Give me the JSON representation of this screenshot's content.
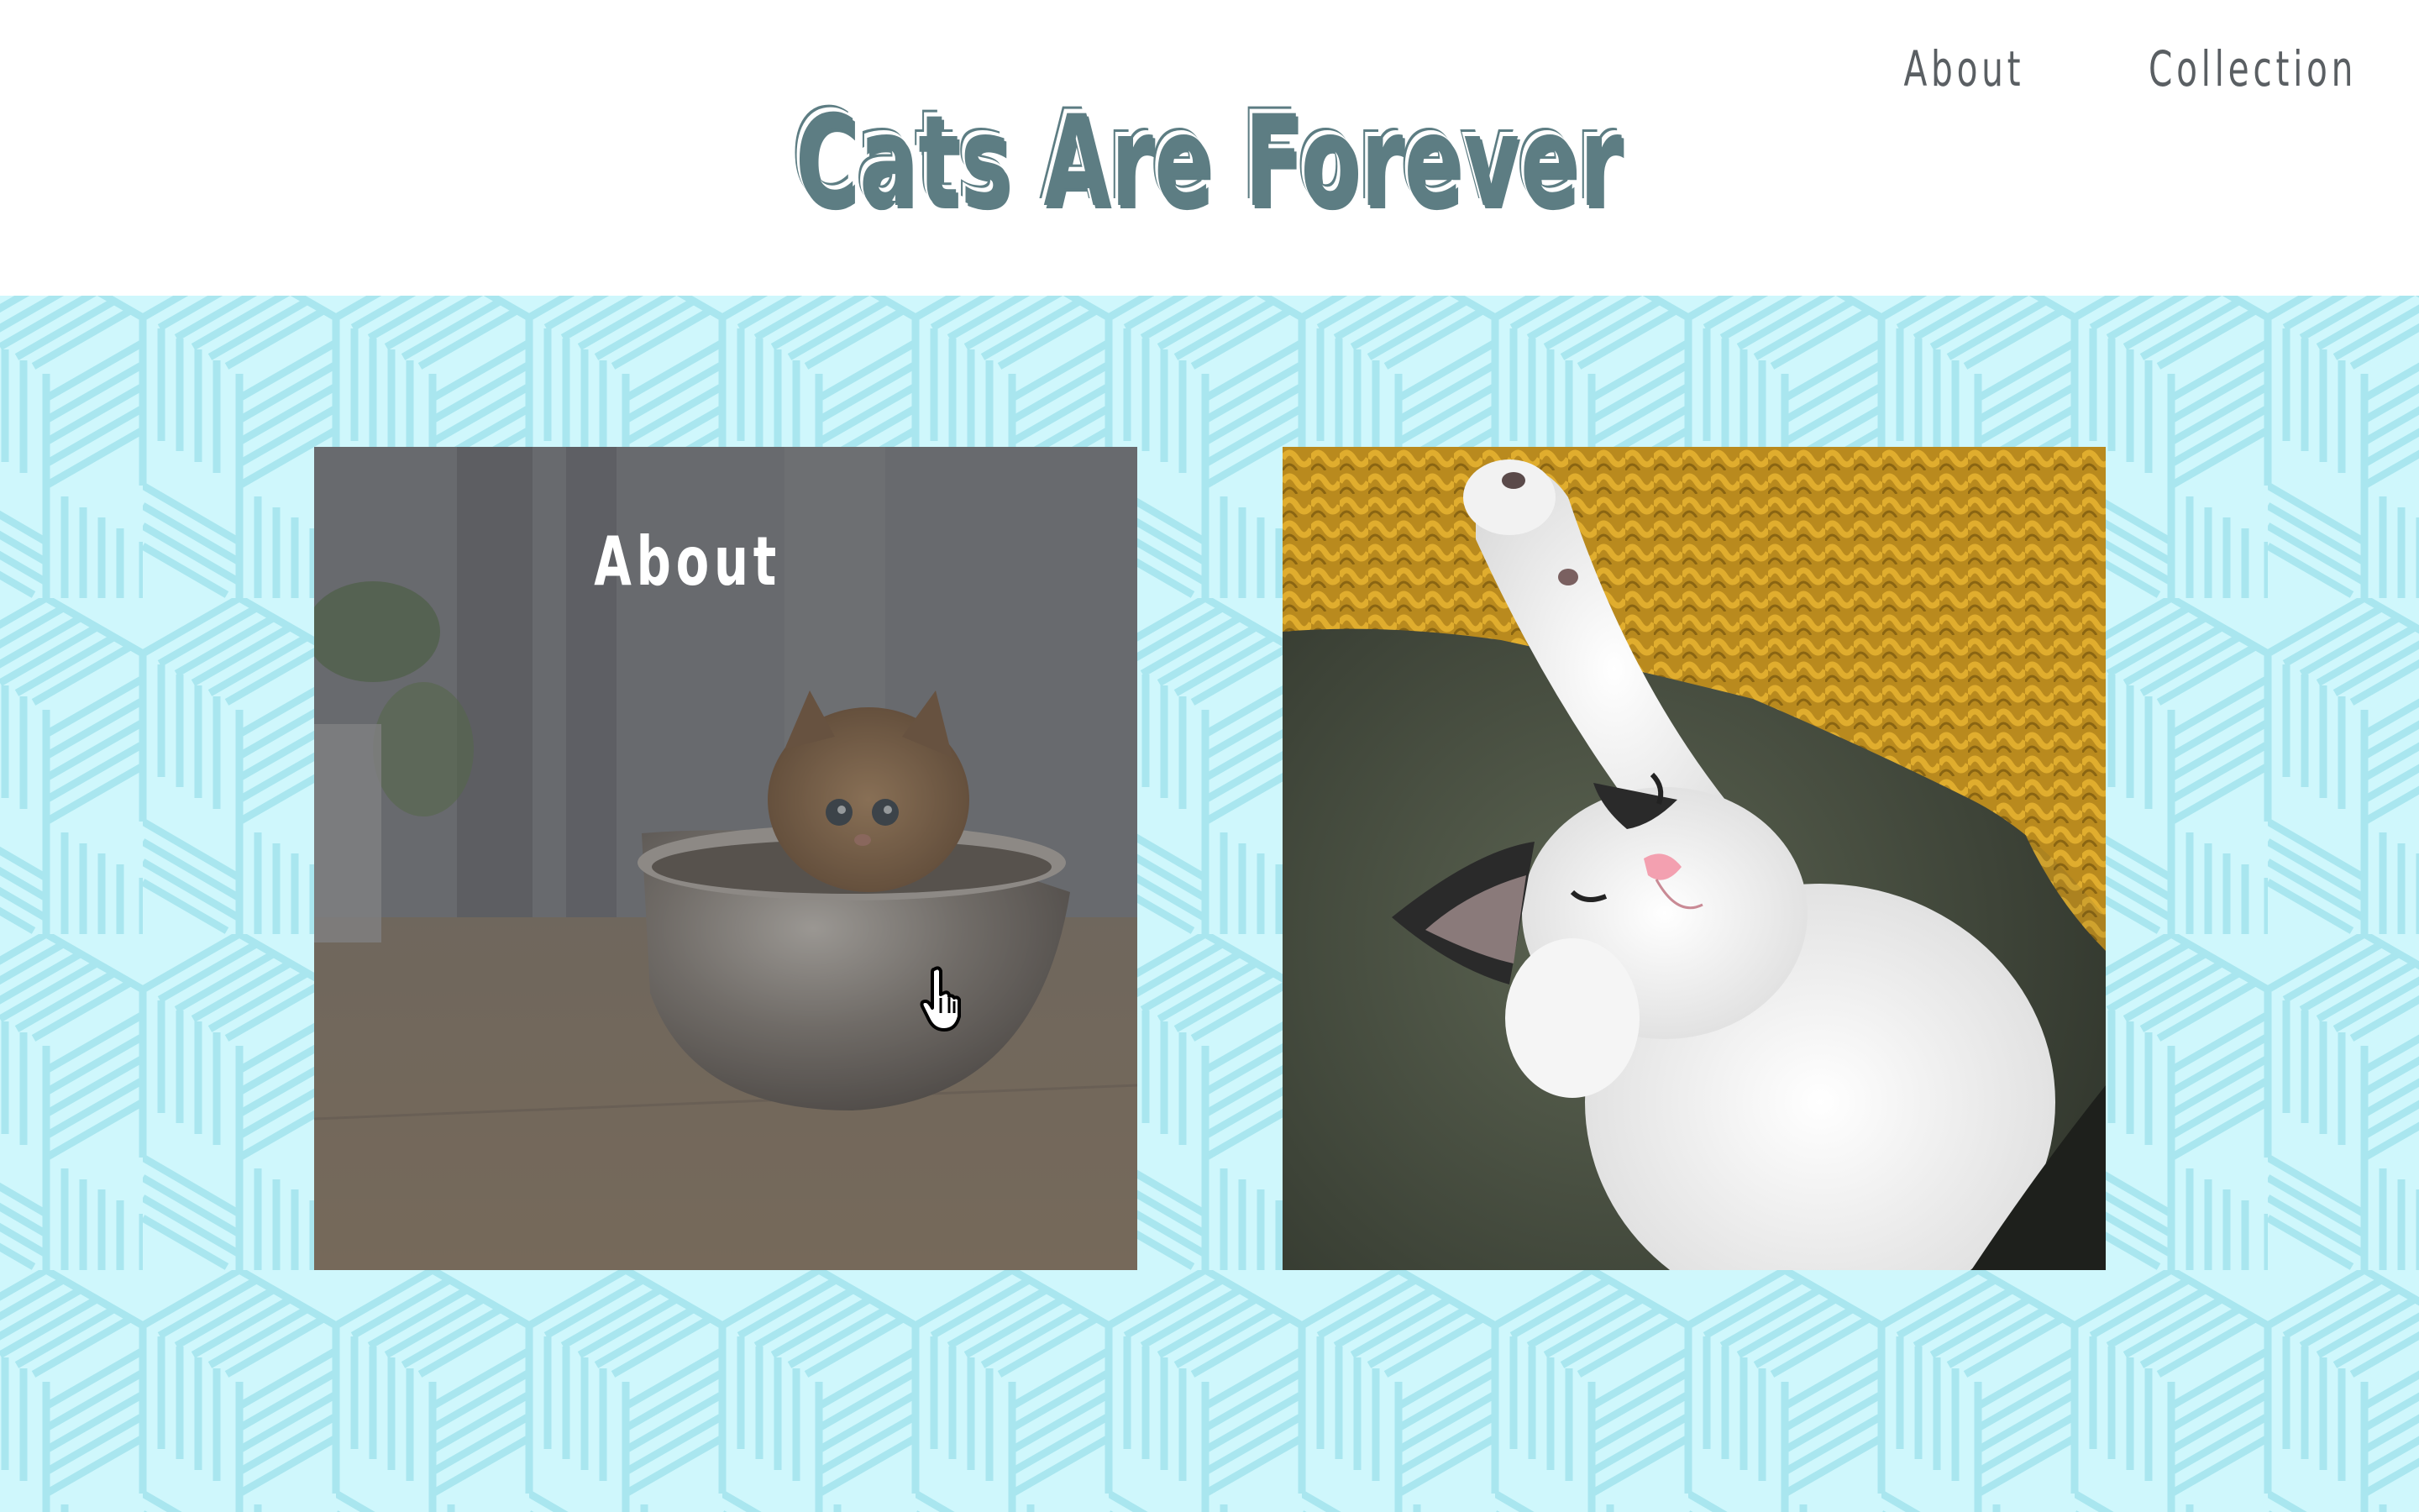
{
  "header": {
    "title": "Cats Are Forever",
    "nav": [
      {
        "label": "About"
      },
      {
        "label": "Collection"
      }
    ]
  },
  "cards": [
    {
      "label": "About",
      "image": "kitten-in-metal-bowl"
    },
    {
      "label": "",
      "image": "white-kitten-stretching-on-yellow-knit"
    }
  ],
  "colors": {
    "title": "#5d7d83",
    "banner_bg": "#cff7fc",
    "pattern_line": "#a9e6ef",
    "nav_text": "#5a5f63"
  },
  "cursor": {
    "icon": "hand-pointer-icon"
  }
}
